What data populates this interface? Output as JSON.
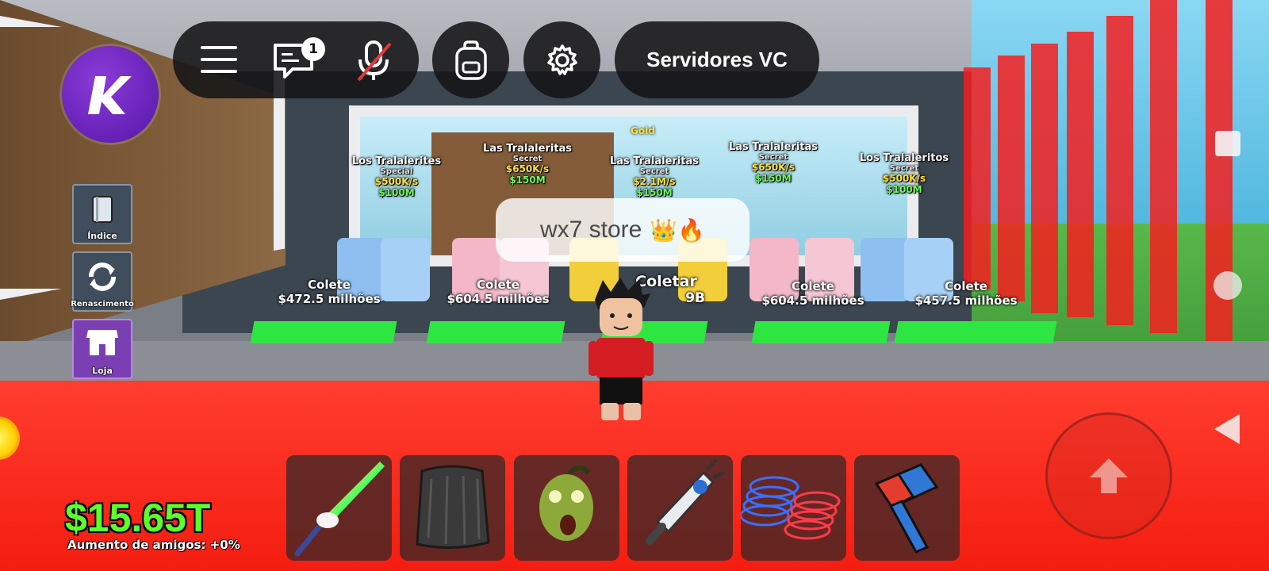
{
  "topbar": {
    "chat_badge": "1",
    "servers_label": "Servidores VC"
  },
  "sidebar": {
    "items": [
      {
        "label": "Índice",
        "icon": "book-icon"
      },
      {
        "label": "Renascimento",
        "icon": "rebirth-icon"
      },
      {
        "label": "Loja",
        "icon": "shop-icon"
      }
    ]
  },
  "pedestals": [
    {
      "name": "Los Tralalerites",
      "tier": "Special",
      "rate": "$500K/s",
      "price": "$100M"
    },
    {
      "name": "Las Tralaleritas",
      "tier": "Secret",
      "rate": "$650K/s",
      "price": "$150M"
    },
    {
      "name": "Las Tralaleritas",
      "tier": "Secret",
      "rate": "$2.1M/s",
      "price": "$150M",
      "mutation": "Gold"
    },
    {
      "name": "Las Tralaleritas",
      "tier": "Secret",
      "rate": "$650K/s",
      "price": "$150M"
    },
    {
      "name": "Los Tralaleritos",
      "tier": "Secret",
      "rate": "$500K/s",
      "price": "$100M"
    }
  ],
  "collectors": [
    {
      "label": "Colete",
      "amount": "$472.5 milhões"
    },
    {
      "label": "Colete",
      "amount": "$604.5 milhões"
    },
    {
      "label": "Coletar",
      "amount": "9B"
    },
    {
      "label": "Colete",
      "amount": "$604.5 milhões"
    },
    {
      "label": "Colete",
      "amount": "$457.5 milhões"
    }
  ],
  "store_sign": {
    "text": "wx7 store",
    "emoji": "👑🔥"
  },
  "hud": {
    "money": "$15.65T",
    "friend_boost": "Aumento de amigos: +0%"
  },
  "hotbar": [
    {
      "icon": "rainbow-unicorn-sword-icon"
    },
    {
      "icon": "cape-icon"
    },
    {
      "icon": "zombie-mask-icon"
    },
    {
      "icon": "grapple-gun-icon"
    },
    {
      "icon": "springs-icon"
    },
    {
      "icon": "hammer-icon"
    }
  ],
  "colors": {
    "money": "#5cff2a",
    "accent_purple": "#6a23c0",
    "hud_bg": "#141416"
  }
}
